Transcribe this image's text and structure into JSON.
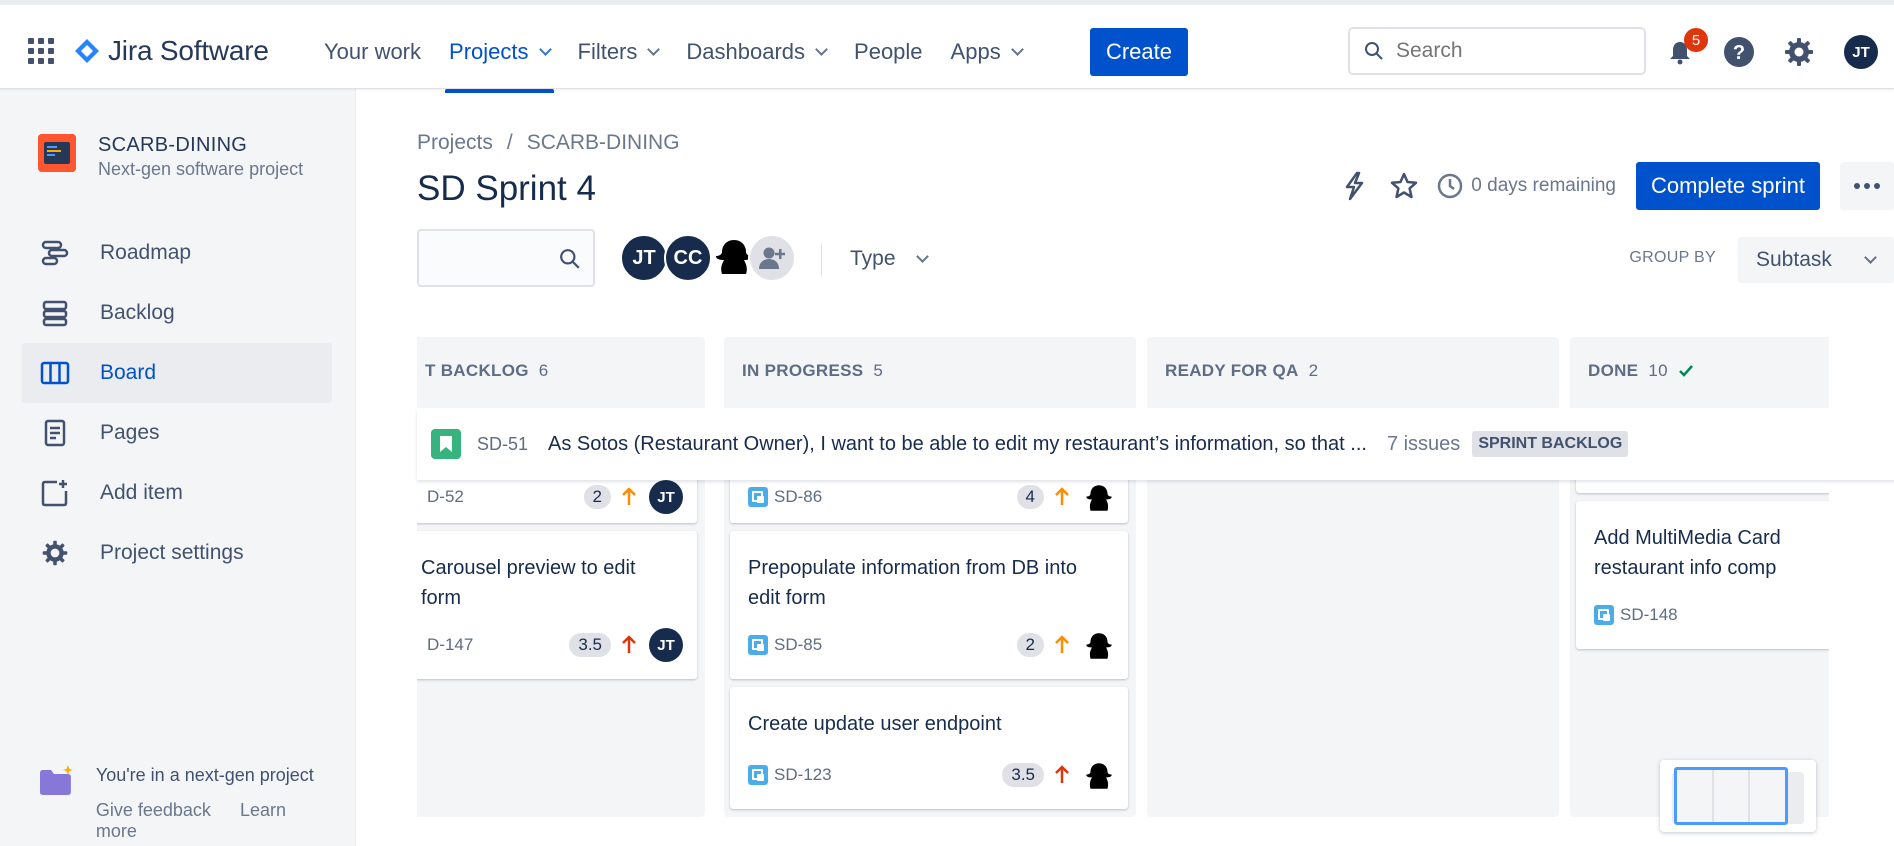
{
  "topbar": {
    "product_name": "Jira Software",
    "nav": [
      {
        "label": "Your work",
        "active": false,
        "dropdown": false
      },
      {
        "label": "Projects",
        "active": true,
        "dropdown": true
      },
      {
        "label": "Filters",
        "active": false,
        "dropdown": true
      },
      {
        "label": "Dashboards",
        "active": false,
        "dropdown": true
      },
      {
        "label": "People",
        "active": false,
        "dropdown": false
      },
      {
        "label": "Apps",
        "active": false,
        "dropdown": true
      }
    ],
    "create_label": "Create",
    "search_placeholder": "Search",
    "notification_count": "5",
    "user_initials": "JT"
  },
  "sidebar": {
    "project_name": "SCARB-DINING",
    "project_type": "Next-gen software project",
    "items": [
      {
        "label": "Roadmap",
        "icon": "roadmap-icon"
      },
      {
        "label": "Backlog",
        "icon": "backlog-icon"
      },
      {
        "label": "Board",
        "icon": "board-icon",
        "active": true
      },
      {
        "label": "Pages",
        "icon": "pages-icon"
      },
      {
        "label": "Add item",
        "icon": "add-item-icon"
      },
      {
        "label": "Project settings",
        "icon": "gear-icon"
      }
    ],
    "footer_text": "You're in a next-gen project",
    "feedback_label": "Give feedback",
    "learn_more_label": "Learn more"
  },
  "main": {
    "breadcrumb": [
      "Projects",
      "SCARB-DINING"
    ],
    "title": "SD Sprint 4",
    "days_remaining": "0 days remaining",
    "complete_sprint_label": "Complete sprint",
    "filter_avatars": [
      "JT",
      "CC"
    ],
    "type_filter_label": "Type",
    "group_by_label": "GROUP BY",
    "group_by_value": "Subtask"
  },
  "board": {
    "columns": [
      {
        "name": "T BACKLOG",
        "count": "6",
        "done": false
      },
      {
        "name": "IN PROGRESS",
        "count": "5",
        "done": false
      },
      {
        "name": "READY FOR QA",
        "count": "2",
        "done": false
      },
      {
        "name": "DONE",
        "count": "10",
        "done": true
      }
    ],
    "swimlane": {
      "key": "SD-51",
      "summary": "As Sotos (Restaurant Owner), I want to be able to edit my restaurant’s information, so that ...",
      "issue_count": "7 issues",
      "status": "SPRINT BACKLOG"
    },
    "cards": {
      "col1_partial": {
        "key": "D-52",
        "estimate": "2",
        "priority": "medium",
        "assignee": "JT"
      },
      "col1_card": {
        "title": "Carousel preview to edit form",
        "key": "D-147",
        "estimate": "3.5",
        "priority": "high",
        "assignee": "JT"
      },
      "col2_partial": {
        "key": "SD-86",
        "estimate": "4",
        "priority": "medium"
      },
      "col2_card1": {
        "title": "Prepopulate information from DB into edit form",
        "key": "SD-85",
        "estimate": "2",
        "priority": "medium"
      },
      "col2_card2": {
        "title": "Create update user endpoint",
        "key": "SD-123",
        "estimate": "3.5",
        "priority": "high"
      },
      "col4_card": {
        "title": "Add MultiMedia Card restaurant info comp",
        "key": "SD-148"
      }
    }
  },
  "colors": {
    "brand_blue": "#0052cc",
    "text_dark": "#172b4d",
    "priority_medium": "#ff8b00",
    "priority_high": "#de350b",
    "story_green": "#36b37e",
    "subtask_blue": "#4bade8"
  }
}
